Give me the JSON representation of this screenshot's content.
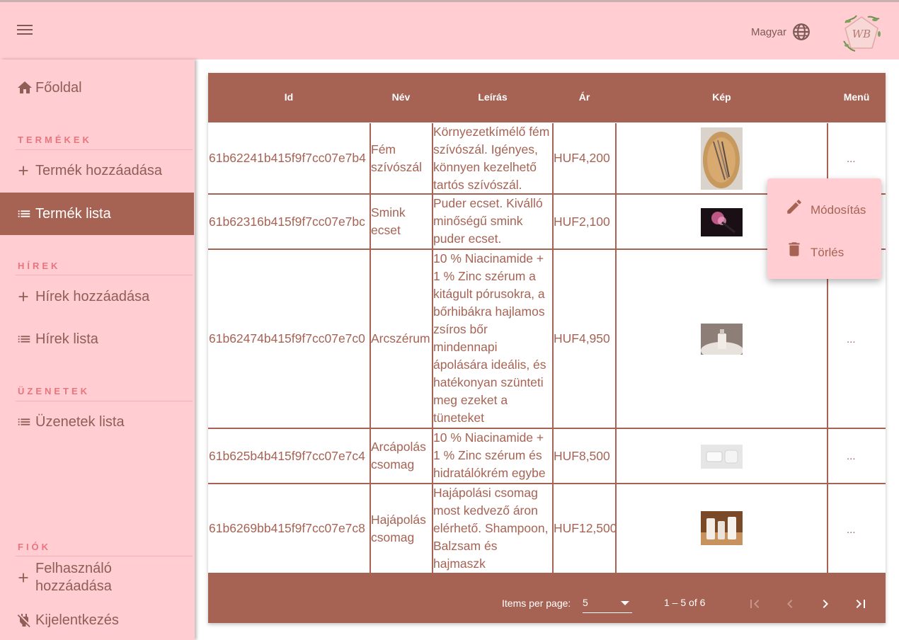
{
  "header": {
    "menu_icon": "hamburger-menu-icon",
    "language_label": "Magyar",
    "language_icon": "globe-icon",
    "logo_monogram": "WB"
  },
  "sidebar": {
    "home": "Főoldal",
    "sections": {
      "products": "TERMÉKEK",
      "news": "HÍREK",
      "messages": "ÜZENETEK",
      "account": "FIÓK"
    },
    "items": {
      "add_product": "Termék hozzáadása",
      "product_list": "Termék lista",
      "add_news": "Hírek hozzáadása",
      "news_list": "Hírek lista",
      "messages_list": "Üzenetek lista",
      "add_user_line1": "Felhasználó",
      "add_user_line2": "hozzáadása",
      "logout": "Kijelentkezés"
    }
  },
  "table": {
    "columns": [
      "Id",
      "Név",
      "Leírás",
      "Ár",
      "Kép",
      "Menü"
    ],
    "rows": [
      {
        "id": "61b62241b415f9f7cc07e7b4",
        "name": "Fém szívószál",
        "description": "Környezetkímélő fém szívószál. Igényes, könnyen kezelhető tartós szívószál.",
        "price": "HUF4,200",
        "menu": "..."
      },
      {
        "id": "61b62316b415f9f7cc07e7bc",
        "name": "Smink ecset",
        "description": "Puder ecset. Kiválló minőségű smink puder ecset.",
        "price": "HUF2,100",
        "menu": "..."
      },
      {
        "id": "61b62474b415f9f7cc07e7c0",
        "name": "Arcszérum",
        "description": "10 % Niacinamide + 1 % Zinc szérum a kitágult pórusokra, a bőrhibákra hajlamos zsíros bőr mindennapi ápolására ideális, és hatékonyan szünteti meg ezeket a tüneteket",
        "price": "HUF4,950",
        "menu": "..."
      },
      {
        "id": "61b625b4b415f9f7cc07e7c4",
        "name": "Arcápolás csomag",
        "description": "10 % Niacinamide + 1 % Zinc szérum és hidratálókrém egybe",
        "price": "HUF8,500",
        "menu": "..."
      },
      {
        "id": "61b6269bb415f9f7cc07e7c8",
        "name": "Hajápolás csomag",
        "description": "Hajápolási csomag most kedvező áron elérhető. Shampoon, Balzsam és hajmaszk",
        "price": "HUF12,500",
        "menu": "..."
      }
    ]
  },
  "paginator": {
    "items_per_page_label": "Items per page:",
    "page_size": "5",
    "range": "1 – 5 of 6"
  },
  "row_menu": {
    "edit": "Módosítás",
    "delete": "Törlés"
  },
  "colors": {
    "primary": "#a66354",
    "background": "#ffcdd2",
    "accent": "#e8757e"
  }
}
